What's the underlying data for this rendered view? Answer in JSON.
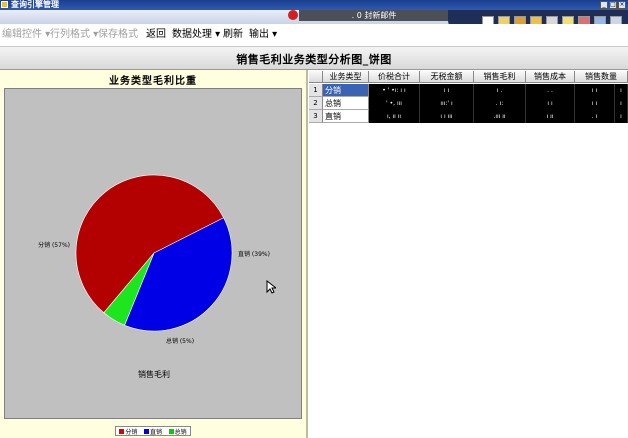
{
  "window": {
    "title": "查询引擎管理",
    "notification": ". 0 封新邮件"
  },
  "menubar": {
    "items": [
      {
        "label": "编辑控件 ▾",
        "enabled": false
      },
      {
        "label": "行列格式 ▾",
        "enabled": false
      },
      {
        "label": "保存格式",
        "enabled": false
      },
      {
        "label": "返回",
        "enabled": true
      },
      {
        "label": "数据处理 ▾",
        "enabled": true
      },
      {
        "label": "刷新",
        "enabled": true
      },
      {
        "label": "输出 ▾",
        "enabled": true
      }
    ]
  },
  "page": {
    "title": "销售毛利业务类型分析图_饼图"
  },
  "chart_data": {
    "type": "pie",
    "title": "业务类型毛利比重",
    "series_label": "销售毛利",
    "categories": [
      "分销",
      "直销",
      "总销"
    ],
    "values": [
      57,
      39,
      5
    ],
    "colors": [
      "#b30000",
      "#0000e6",
      "#1ee61e"
    ],
    "slice_labels": [
      "分销 (57%)",
      "直销 (39%)",
      "总销 (5%)"
    ]
  },
  "legend": [
    {
      "label": "分销",
      "color": "#e00000"
    },
    {
      "label": "直销",
      "color": "#0000e0"
    },
    {
      "label": "总销",
      "color": "#00d000"
    }
  ],
  "table": {
    "columns": [
      "业务类型",
      "价税合计",
      "无税金额",
      "销售毛利",
      "销售成本",
      "销售数量"
    ],
    "rows": [
      {
        "num": "1",
        "name": "分销",
        "values": [
          "• ' •ı: ı ı",
          "ı ı",
          "ı .",
          ". .",
          "ı ı",
          "ı"
        ]
      },
      {
        "num": "2",
        "name": "总销",
        "values": [
          "' •, ııı",
          "ııı:' ı",
          ". ı:",
          "ı ı",
          "ı ı",
          "ı"
        ]
      },
      {
        "num": "3",
        "name": "直销",
        "values": [
          "ı, ıı ıı",
          "ı ı ııı",
          ".ııı ıı",
          "ı ıı",
          ". ı",
          "ı"
        ]
      }
    ]
  }
}
